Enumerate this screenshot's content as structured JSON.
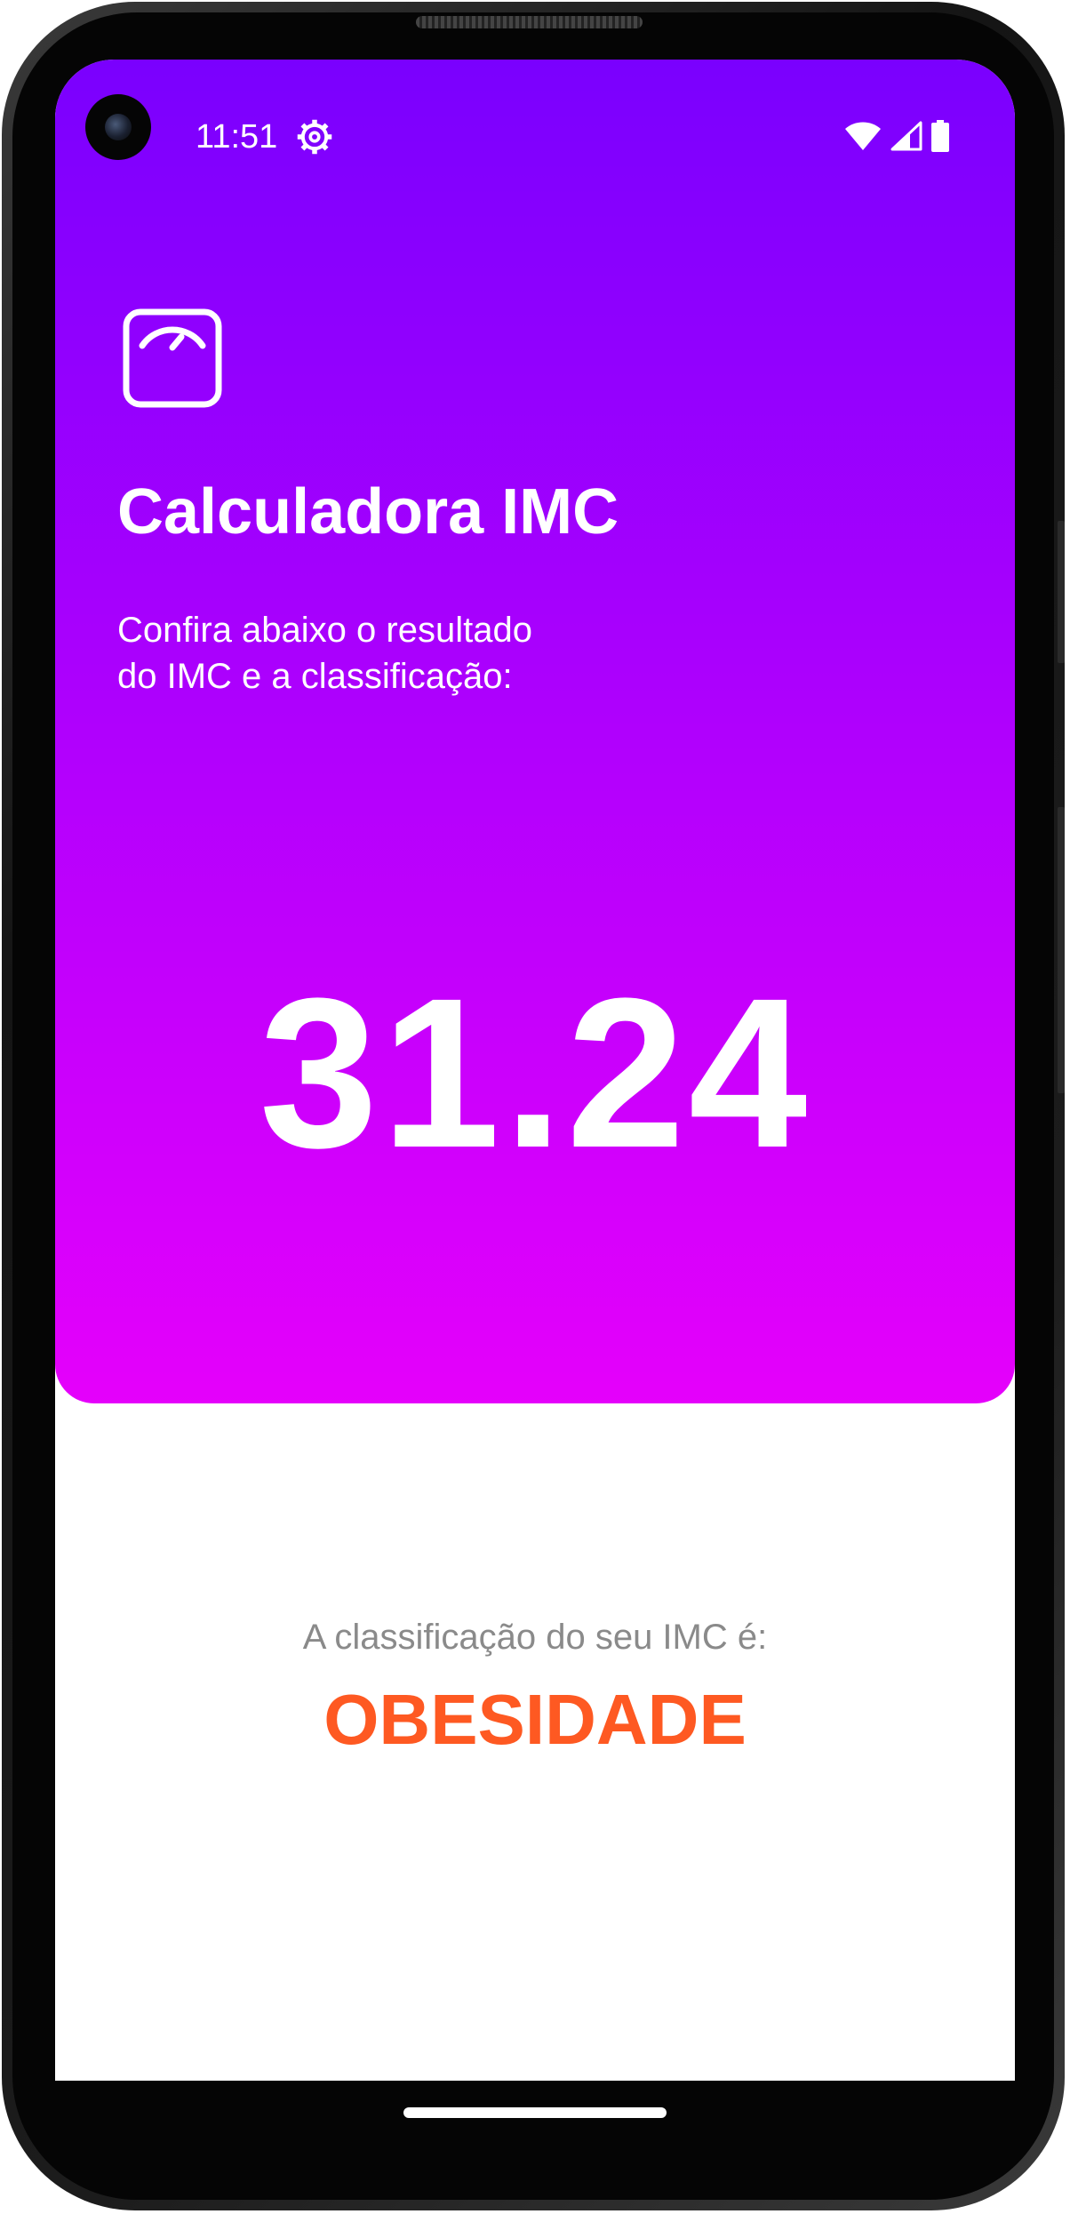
{
  "status_bar": {
    "time": "11:51",
    "icons": [
      "gear-icon",
      "wifi-icon",
      "signal-icon",
      "battery-icon"
    ]
  },
  "app": {
    "logo_icon": "scale-icon",
    "title": "Calculadora IMC",
    "subtitle_line1": "Confira abaixo o resultado",
    "subtitle_line2": "do IMC e a classificação:",
    "imc_value": "31.24"
  },
  "result": {
    "label": "A classificação do seu IMC é:",
    "classification": "OBESIDADE"
  },
  "colors": {
    "gradient_top": "#7a00fe",
    "gradient_bottom": "#e500fb",
    "classification": "#fe5922",
    "label_gray": "#8a8a8a"
  }
}
